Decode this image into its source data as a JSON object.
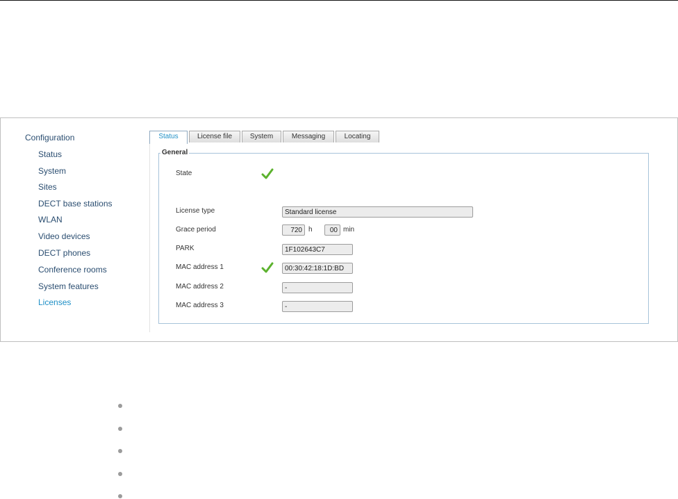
{
  "sidebar": {
    "title": "Configuration",
    "items": [
      {
        "label": "Status"
      },
      {
        "label": "System"
      },
      {
        "label": "Sites"
      },
      {
        "label": "DECT base stations"
      },
      {
        "label": "WLAN"
      },
      {
        "label": "Video devices"
      },
      {
        "label": "DECT phones"
      },
      {
        "label": "Conference rooms"
      },
      {
        "label": "System features"
      },
      {
        "label": "Licenses",
        "active": true
      }
    ]
  },
  "tabs": [
    {
      "label": "Status",
      "active": true
    },
    {
      "label": "License file"
    },
    {
      "label": "System"
    },
    {
      "label": "Messaging"
    },
    {
      "label": "Locating"
    }
  ],
  "general": {
    "legend": "General",
    "state_label": "State",
    "state_icon": "checkmark-icon",
    "license_type_label": "License type",
    "license_type_value": "Standard license",
    "grace_period_label": "Grace period",
    "grace_hours_value": "720",
    "grace_hours_unit": "h",
    "grace_minutes_value": "00",
    "grace_minutes_unit": "min",
    "park_label": "PARK",
    "park_value": "1F102643C7",
    "mac1_label": "MAC address 1",
    "mac1_value": "00:30:42:18:1D:BD",
    "mac2_label": "MAC address 2",
    "mac2_value": "-",
    "mac3_label": "MAC address 3",
    "mac3_value": "-"
  },
  "colors": {
    "link": "#2a4d70",
    "active": "#1e8fc6",
    "check": "#5cb22e",
    "box_border": "#a7c3da"
  }
}
